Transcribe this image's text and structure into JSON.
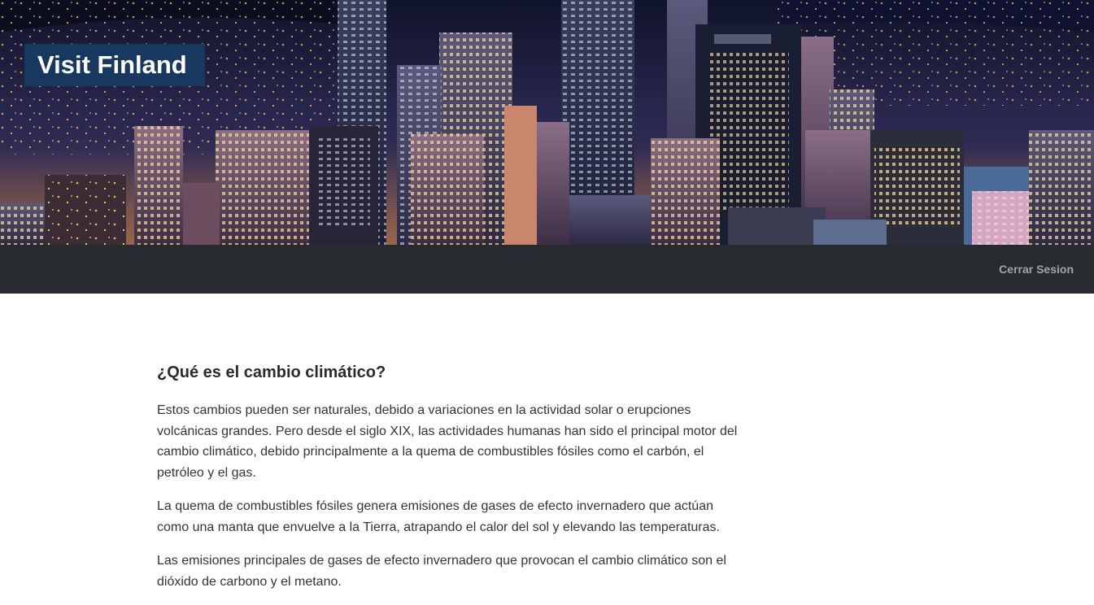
{
  "header": {
    "brand_title": "Visit Finland",
    "hero_image": "night-city-skyline",
    "brand_bg_color": "#17395f"
  },
  "nav": {
    "logout_label": "Cerrar Sesion",
    "bg_color": "#272b30"
  },
  "main": {
    "heading": "¿Qué es el cambio climático?",
    "paragraphs": [
      "Estos cambios pueden ser naturales, debido a variaciones en la actividad solar o erupciones volcánicas grandes. Pero desde el siglo XIX, las actividades humanas han sido el principal motor del cambio climático, debido principalmente a la quema de combustibles fósiles como el carbón, el petróleo y el gas.",
      "La quema de combustibles fósiles genera emisiones de gases de efecto invernadero que actúan como una manta que envuelve a la Tierra, atrapando el calor del sol y elevando las temperaturas.",
      "Las emisiones principales de gases de efecto invernadero que provocan el cambio climático son el dióxido de carbono y el metano."
    ]
  }
}
